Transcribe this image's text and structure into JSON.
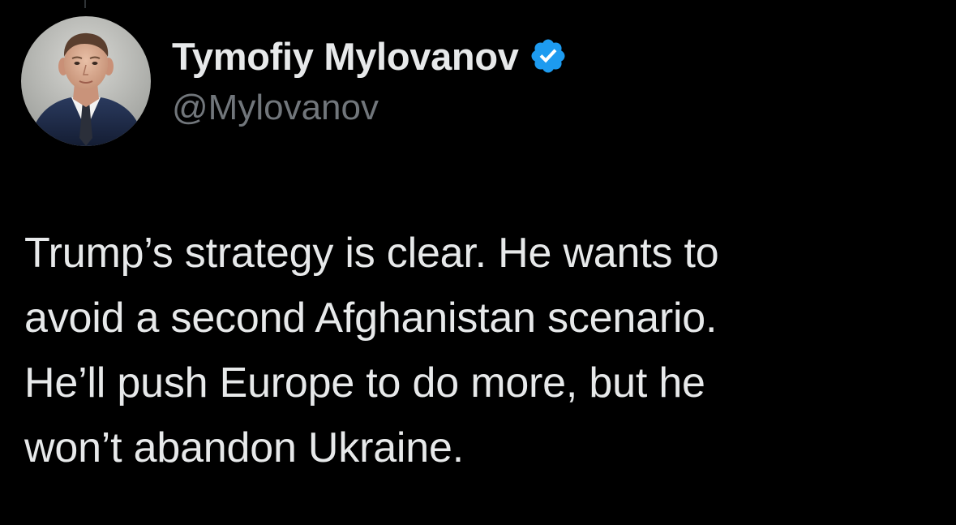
{
  "author": {
    "display_name": "Tymofiy Mylovanov",
    "handle": "@Mylovanov",
    "verified_icon": "verified-badge-icon",
    "avatar_icon": "profile-photo"
  },
  "tweet": {
    "lines": [
      "Trump’s strategy is clear. He wants to",
      "avoid a second Afghanistan scenario.",
      "He’ll push Europe to do more, but he",
      "won’t abandon Ukraine."
    ]
  },
  "colors": {
    "background": "#000000",
    "text_primary": "#e7e9ea",
    "text_secondary": "#71767b",
    "verified_blue": "#1d9bf0"
  }
}
